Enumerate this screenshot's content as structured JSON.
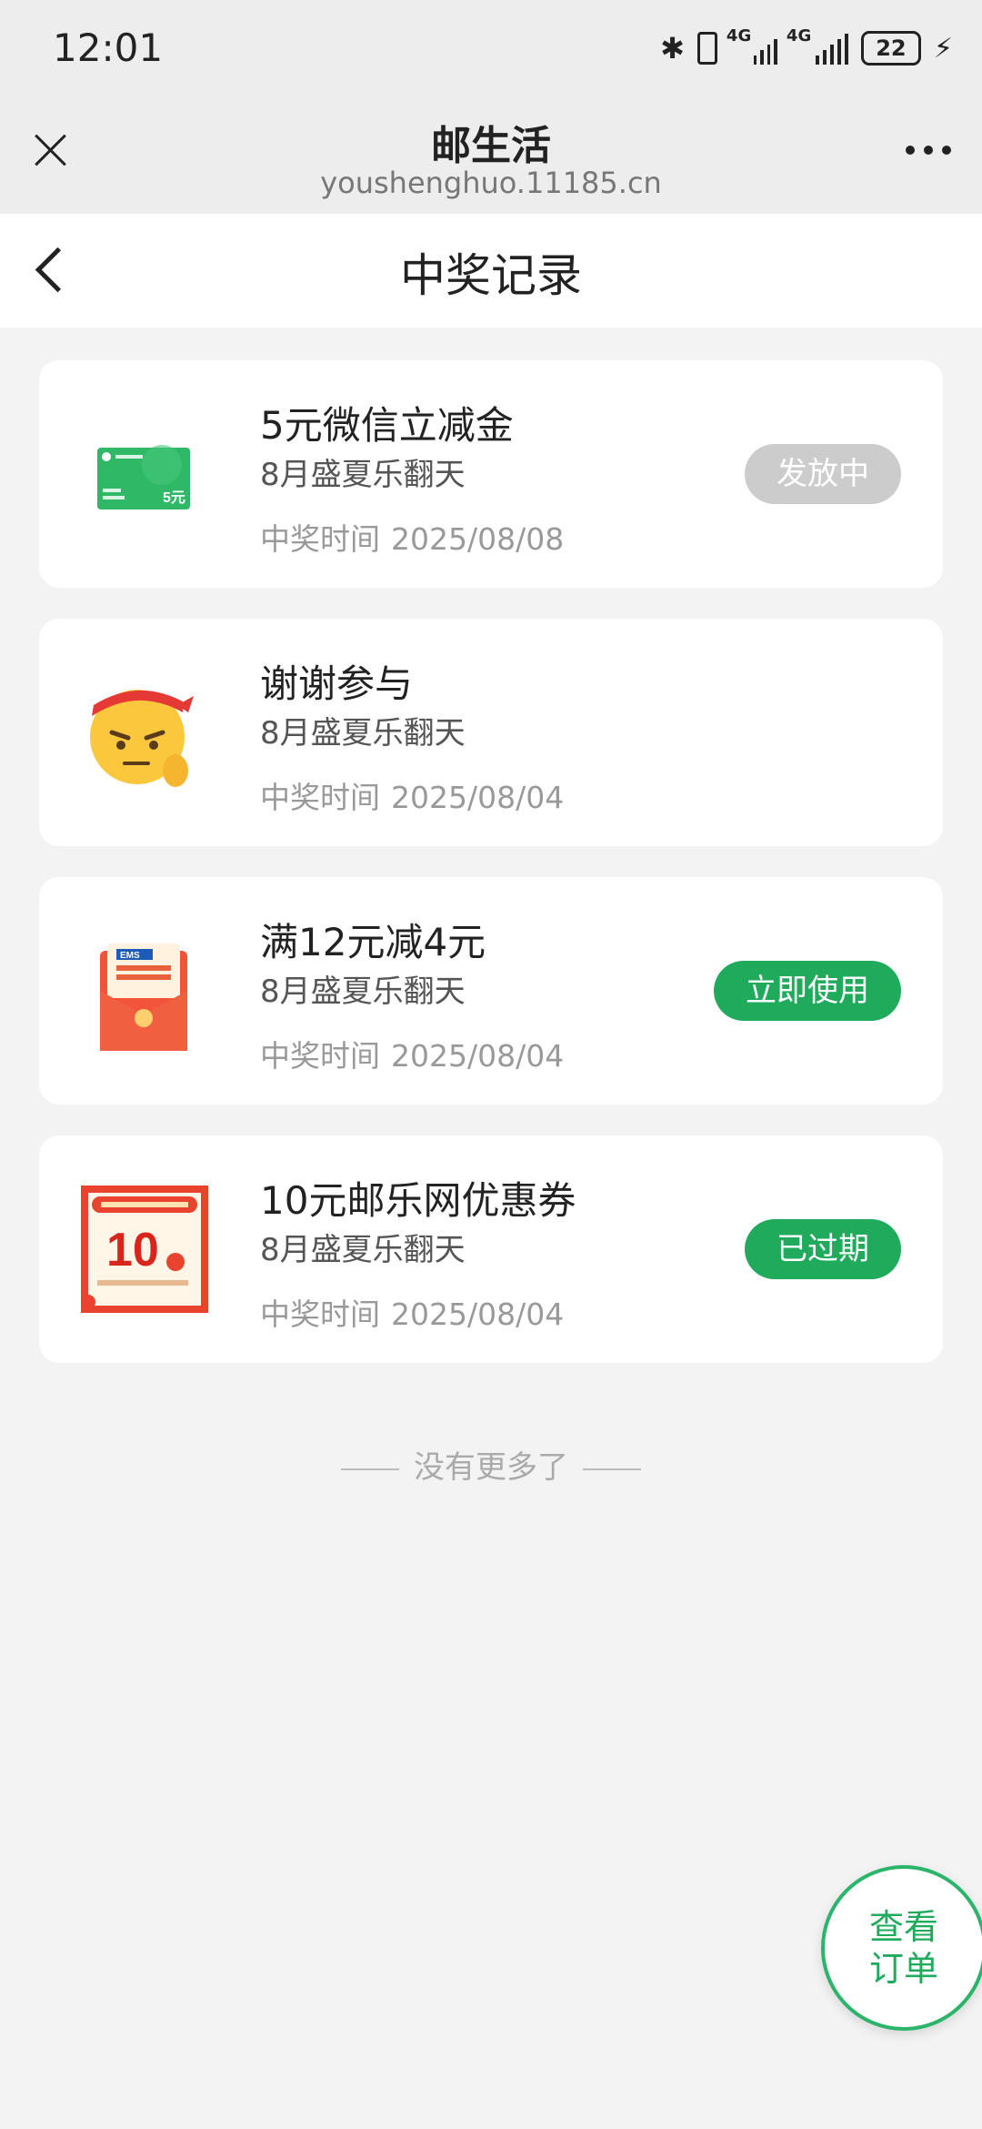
{
  "status": {
    "time": "12:01",
    "network1": "4G",
    "network2": "4G",
    "battery": "22"
  },
  "browser": {
    "title": "邮生活",
    "url": "youshenghuo.11185.cn"
  },
  "page": {
    "title": "中奖记录"
  },
  "prizes": [
    {
      "title": "5元微信立减金",
      "subtitle": "8月盛夏乐翻天",
      "time_label": "中奖时间",
      "date": "2025/08/08",
      "action": "发放中",
      "thumb_text": "5元"
    },
    {
      "title": "谢谢参与",
      "subtitle": "8月盛夏乐翻天",
      "time_label": "中奖时间",
      "date": "2025/08/04"
    },
    {
      "title": "满12元减4元",
      "subtitle": "8月盛夏乐翻天",
      "time_label": "中奖时间",
      "date": "2025/08/04",
      "action": "立即使用",
      "thumb_text": "EMS"
    },
    {
      "title": "10元邮乐网优惠券",
      "subtitle": "8月盛夏乐翻天",
      "time_label": "中奖时间",
      "date": "2025/08/04",
      "action": "已过期",
      "thumb_text": "10"
    }
  ],
  "footer": {
    "no_more": "没有更多了"
  },
  "fab": {
    "line1": "查看",
    "line2": "订单"
  }
}
